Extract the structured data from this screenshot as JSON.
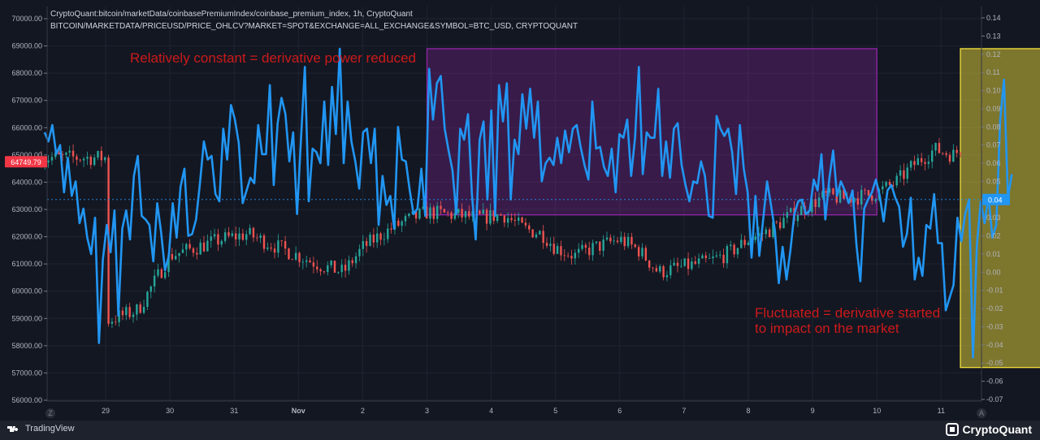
{
  "header": {
    "line1": "CryptoQuant:bitcoin/marketData/coinbasePremiumIndex/coinbase_premium_index, 1h, CryptoQuant",
    "line2": "BITCOIN/MARKETDATA/PRICEUSD/PRICE_OHLCV?MARKET=SPOT&EXCHANGE=ALL_EXCHANGE&SYMBOL=BTC_USD, CRYPTOQUANT"
  },
  "annotations": {
    "constant": "Relatively constant = derivative power reduced",
    "fluct_line1": "Fluctuated = derivative started",
    "fluct_line2": "to impact on the market"
  },
  "footer": {
    "left_brand": "TradingView",
    "right_brand": "CryptoQuant"
  },
  "corner_left": "Z",
  "corner_right": "A",
  "colors": {
    "background": "#131722",
    "premium_line": "#2196f3",
    "candle_up": "#26a69a",
    "candle_down": "#ef5350",
    "purple_box": "#9c27b0",
    "yellow_box": "#ffeb3b",
    "annotation": "#cc1a1a",
    "price_badge": "#f23645",
    "premium_badge": "#2196f3"
  },
  "chart_data": {
    "type": "line",
    "x_tick_labels": [
      "29",
      "30",
      "31",
      "Nov",
      "2",
      "3",
      "4",
      "5",
      "6",
      "7",
      "8",
      "9",
      "10",
      "11"
    ],
    "left_axis": {
      "ticks": [
        "70000.00",
        "69000.00",
        "68000.00",
        "67000.00",
        "66000.00",
        "65000.00",
        "64000.00",
        "63000.00",
        "62000.00",
        "61000.00",
        "60000.00",
        "59000.00",
        "58000.00",
        "57000.00",
        "56000.00"
      ],
      "range": [
        56000,
        70000
      ],
      "last_price_label": "64749.79",
      "last_price": 64749.79
    },
    "right_axis": {
      "ticks": [
        "0.14",
        "0.13",
        "0.12",
        "0.11",
        "0.10",
        "0.09",
        "0.08",
        "0.07",
        "0.06",
        "0.05",
        "0.04",
        "0.03",
        "0.02",
        "0.01",
        "0.00",
        "-0.01",
        "-0.02",
        "-0.03",
        "-0.04",
        "-0.05",
        "-0.06",
        "-0.07"
      ],
      "range": [
        -0.07,
        0.14
      ],
      "last_value_label": "0.04",
      "last_value": 0.04
    },
    "price_path": [
      [
        0.0,
        58900
      ],
      [
        0.5,
        59300
      ],
      [
        1.0,
        61300
      ],
      [
        1.4,
        61600
      ],
      [
        1.8,
        61900
      ],
      [
        2.2,
        62100
      ],
      [
        2.6,
        61700
      ],
      [
        3.0,
        61300
      ],
      [
        3.4,
        60900
      ],
      [
        3.7,
        60700
      ],
      [
        4.0,
        61600
      ],
      [
        4.3,
        62100
      ],
      [
        4.6,
        62500
      ],
      [
        5.0,
        62900
      ],
      [
        5.4,
        62800
      ],
      [
        5.8,
        62700
      ],
      [
        6.2,
        62800
      ],
      [
        6.5,
        62300
      ],
      [
        6.8,
        62100
      ],
      [
        7.0,
        61600
      ],
      [
        7.3,
        61300
      ],
      [
        7.6,
        61600
      ],
      [
        8.0,
        61900
      ],
      [
        8.3,
        61500
      ],
      [
        8.6,
        60700
      ],
      [
        9.0,
        60900
      ],
      [
        9.4,
        61100
      ],
      [
        9.7,
        61400
      ],
      [
        10.0,
        61900
      ],
      [
        10.3,
        62200
      ],
      [
        10.6,
        62700
      ],
      [
        10.9,
        63100
      ],
      [
        11.2,
        63500
      ],
      [
        11.5,
        63400
      ],
      [
        11.8,
        63500
      ],
      [
        12.0,
        63600
      ],
      [
        12.3,
        64000
      ],
      [
        12.6,
        64700
      ],
      [
        12.9,
        65200
      ],
      [
        13.2,
        65000
      ],
      [
        13.5,
        65700
      ],
      [
        13.8,
        66200
      ],
      [
        14.1,
        66700
      ],
      [
        14.4,
        67100
      ],
      [
        14.7,
        66800
      ],
      [
        15.0,
        67500
      ],
      [
        15.3,
        67400
      ],
      [
        15.6,
        66900
      ],
      [
        15.9,
        67200
      ],
      [
        16.2,
        66700
      ],
      [
        16.5,
        66600
      ],
      [
        16.8,
        67000
      ],
      [
        17.0,
        67200
      ],
      [
        17.2,
        66200
      ],
      [
        17.4,
        64900
      ]
    ],
    "premium_index": [
      0.077,
      0.072,
      0.081,
      0.065,
      0.07,
      0.044,
      0.063,
      0.042,
      0.05,
      0.027,
      0.035,
      0.019,
      0.01,
      0.03,
      -0.039,
      0.007,
      0.026,
      0.011,
      0.034,
      -0.024,
      0.024,
      0.034,
      0.018,
      0.053,
      0.064,
      0.031,
      0.029,
      0.026,
      0.006,
      0.038,
      0.022,
      0.001,
      0.009,
      0.038,
      0.019,
      0.047,
      0.057,
      0.02,
      0.021,
      0.029,
      0.049,
      0.072,
      0.062,
      0.064,
      0.043,
      0.039,
      0.079,
      0.062,
      0.092,
      0.084,
      0.071,
      0.038,
      0.045,
      0.052,
      0.049,
      0.081,
      0.065,
      0.065,
      0.103,
      0.048,
      0.082,
      0.096,
      0.087,
      0.061,
      0.077,
      0.032,
      0.073,
      0.113,
      0.039,
      0.068,
      0.066,
      0.06,
      0.094,
      0.059,
      0.102,
      0.076,
      0.123,
      0.06,
      0.094,
      0.072,
      0.061,
      0.046,
      0.077,
      0.079,
      0.06,
      0.079,
      0.026,
      0.053,
      0.037,
      0.042,
      0.024,
      0.08,
      0.062,
      0.061,
      0.045,
      0.032,
      0.035,
      0.057,
      0.031,
      0.112,
      0.084,
      0.104,
      0.108,
      0.079,
      0.067,
      0.056,
      0.032,
      0.079,
      0.073,
      0.087,
      0.043,
      0.018,
      0.073,
      0.083,
      0.04,
      0.089,
      0.031,
      0.103,
      0.083,
      0.104,
      0.04,
      0.073,
      0.065,
      0.098,
      0.079,
      0.101,
      0.074,
      0.094,
      0.05,
      0.06,
      0.063,
      0.059,
      0.074,
      0.06,
      0.078,
      0.066,
      0.079,
      0.081,
      0.069,
      0.059,
      0.051,
      0.094,
      0.068,
      0.069,
      0.058,
      0.053,
      0.068,
      0.044,
      0.076,
      0.074,
      0.084,
      0.053,
      0.074,
      0.113,
      0.054,
      0.077,
      0.074,
      0.074,
      0.101,
      0.053,
      0.072,
      0.052,
      0.079,
      0.082,
      0.059,
      0.048,
      0.039,
      0.05,
      0.049,
      0.061,
      0.053,
      0.031,
      0.03,
      0.086,
      0.079,
      0.075,
      0.079,
      0.066,
      0.043,
      0.081,
      0.057,
      0.044,
      0.008,
      0.042,
      0.009,
      0.029,
      0.05,
      0.037,
      0.023,
      -0.006,
      0.014,
      -0.004,
      0.012,
      0.032,
      0.039,
      0.04,
      0.032,
      0.034,
      0.051,
      0.045,
      0.065,
      0.029,
      0.051,
      0.067,
      0.042,
      0.05,
      0.045,
      0.038,
      0.045,
      0.015,
      -0.005,
      0.035,
      0.04,
      0.044,
      0.051,
      0.042,
      0.028,
      0.045,
      0.048,
      0.041,
      0.036,
      0.014,
      0.021,
      0.041,
      -0.004,
      0.008,
      -0.002,
      0.026,
      0.024,
      0.043,
      0.016,
      0.016,
      -0.021,
      -0.014,
      -0.007,
      0.03,
      0.017,
      0.032,
      0.04,
      -0.047,
      0.015,
      0.039,
      0.027,
      0.042,
      0.019,
      0.026,
      0.084,
      0.106,
      0.041,
      0.054
    ],
    "highlight_boxes": [
      {
        "x_range": [
          5.0,
          12.0
        ],
        "y_range": [
          62800,
          68900
        ],
        "color": "purple"
      },
      {
        "x_range": [
          13.3,
          15.1
        ],
        "y_range": [
          57200,
          68900
        ],
        "color": "yellow"
      }
    ],
    "grid": true
  }
}
